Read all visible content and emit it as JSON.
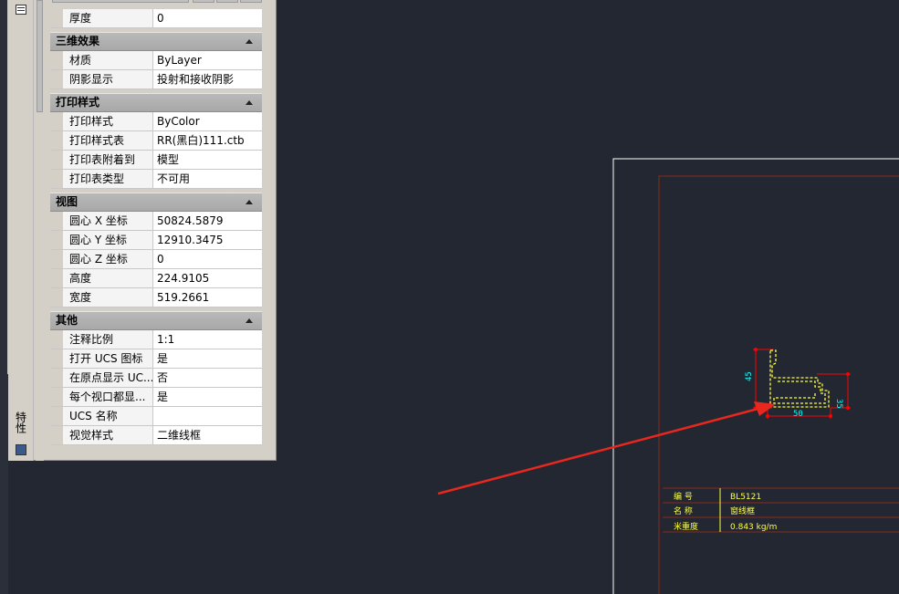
{
  "palette": {
    "title": "特性",
    "sections": [
      {
        "header": "",
        "rows": [
          {
            "key": "厚度",
            "value": "0"
          }
        ]
      },
      {
        "header": "三维效果",
        "rows": [
          {
            "key": "材质",
            "value": "ByLayer"
          },
          {
            "key": "阴影显示",
            "value": "投射和接收阴影"
          }
        ]
      },
      {
        "header": "打印样式",
        "rows": [
          {
            "key": "打印样式",
            "value": "ByColor"
          },
          {
            "key": "打印样式表",
            "value": "RR(黑白)111.ctb"
          },
          {
            "key": "打印表附着到",
            "value": "模型"
          },
          {
            "key": "打印表类型",
            "value": "不可用"
          }
        ]
      },
      {
        "header": "视图",
        "rows": [
          {
            "key": "圆心 X 坐标",
            "value": "50824.5879"
          },
          {
            "key": "圆心 Y 坐标",
            "value": "12910.3475"
          },
          {
            "key": "圆心 Z 坐标",
            "value": "0"
          },
          {
            "key": "高度",
            "value": "224.9105"
          },
          {
            "key": "宽度",
            "value": "519.2661"
          }
        ]
      },
      {
        "header": "其他",
        "rows": [
          {
            "key": "注释比例",
            "value": "1:1"
          },
          {
            "key": "打开 UCS 图标",
            "value": "是"
          },
          {
            "key": "在原点显示 UC...",
            "value": "否"
          },
          {
            "key": "每个视口都显...",
            "value": "是"
          },
          {
            "key": "UCS 名称",
            "value": ""
          },
          {
            "key": "视觉样式",
            "value": "二维线框"
          }
        ]
      }
    ]
  },
  "drawing": {
    "dimensions": {
      "left": "45",
      "right": "35",
      "bottom": "50"
    },
    "table": [
      {
        "label": "编 号",
        "value": "BL5121"
      },
      {
        "label": "名 称",
        "value": "窗线框"
      },
      {
        "label": "米重度",
        "value": "0.843  kg/m"
      }
    ]
  },
  "colors": {
    "background": "#222731",
    "frame_outer": "#ffffff",
    "frame_inner": "#8b2a1c",
    "profile": "#ffff40",
    "dimension_line": "#ff0000",
    "dimension_text": "#00ffff",
    "arrow": "#e8271e"
  }
}
